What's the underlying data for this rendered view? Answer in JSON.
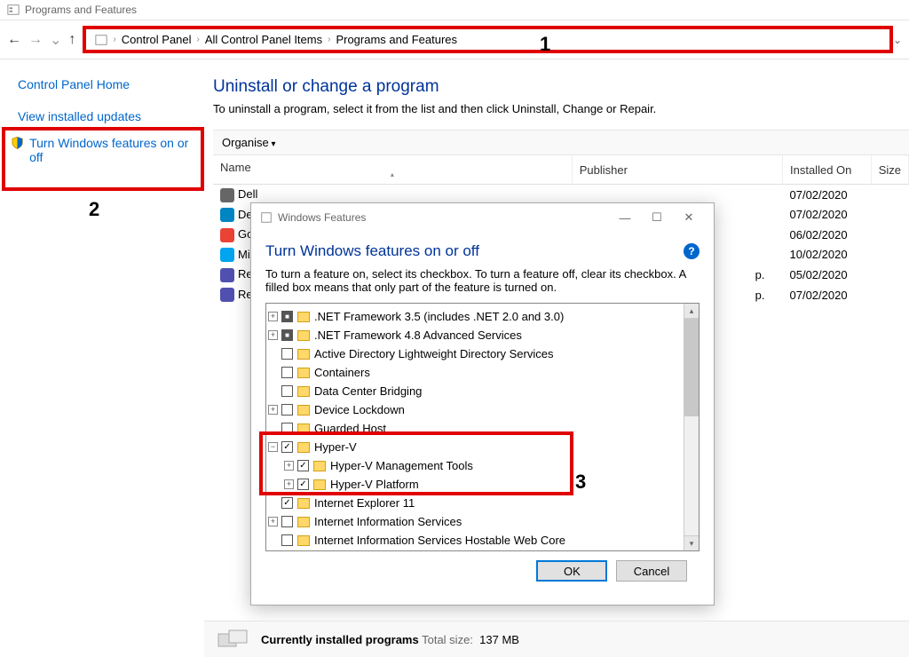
{
  "window_title": "Programs and Features",
  "nav": {
    "back": "←",
    "forward": "→",
    "dropdown": "⌄",
    "up": "↑"
  },
  "breadcrumb": [
    "Control Panel",
    "All Control Panel Items",
    "Programs and Features"
  ],
  "sidebar": {
    "home": "Control Panel Home",
    "updates": "View installed updates",
    "features": "Turn Windows features on or off"
  },
  "page": {
    "heading": "Uninstall or change a program",
    "sub": "To uninstall a program, select it from the list and then click Uninstall, Change or Repair.",
    "organise": "Organise"
  },
  "columns": {
    "name": "Name",
    "publisher": "Publisher",
    "installed": "Installed On",
    "size": "Size"
  },
  "programs": [
    {
      "name": "Dell",
      "installed": "07/02/2020",
      "icon": "#666"
    },
    {
      "name": "Dell",
      "installed": "07/02/2020",
      "icon": "#0085c3"
    },
    {
      "name": "Goo",
      "installed": "06/02/2020",
      "icon": "#ea4335"
    },
    {
      "name": "Micr",
      "installed": "10/02/2020",
      "icon": "#00a4ef"
    },
    {
      "name": "Real",
      "pub_suffix": "p.",
      "installed": "05/02/2020",
      "icon": "#5050b0"
    },
    {
      "name": "Real",
      "pub_suffix": "p.",
      "installed": "07/02/2020",
      "icon": "#5050b0"
    }
  ],
  "dialog": {
    "title": "Windows Features",
    "heading": "Turn Windows features on or off",
    "desc": "To turn a feature on, select its checkbox. To turn a feature off, clear its checkbox. A filled box means that only part of the feature is turned on.",
    "ok": "OK",
    "cancel": "Cancel",
    "features": [
      {
        "exp": "+",
        "cb": "mixed",
        "label": ".NET Framework 3.5 (includes .NET 2.0 and 3.0)",
        "ind": 0
      },
      {
        "exp": "+",
        "cb": "mixed",
        "label": ".NET Framework 4.8 Advanced Services",
        "ind": 0
      },
      {
        "exp": "",
        "cb": "",
        "label": "Active Directory Lightweight Directory Services",
        "ind": 0
      },
      {
        "exp": "",
        "cb": "",
        "label": "Containers",
        "ind": 0
      },
      {
        "exp": "",
        "cb": "",
        "label": "Data Center Bridging",
        "ind": 0
      },
      {
        "exp": "+",
        "cb": "",
        "label": "Device Lockdown",
        "ind": 0
      },
      {
        "exp": "",
        "cb": "",
        "label": "Guarded Host",
        "ind": 0
      },
      {
        "exp": "−",
        "cb": "checked",
        "label": "Hyper-V",
        "ind": 0,
        "hl": true
      },
      {
        "exp": "+",
        "cb": "checked",
        "label": "Hyper-V Management Tools",
        "ind": 1,
        "hl": true
      },
      {
        "exp": "+",
        "cb": "checked",
        "label": "Hyper-V Platform",
        "ind": 1,
        "hl": true
      },
      {
        "exp": "",
        "cb": "checked",
        "label": "Internet Explorer 11",
        "ind": 0
      },
      {
        "exp": "+",
        "cb": "",
        "label": "Internet Information Services",
        "ind": 0
      },
      {
        "exp": "",
        "cb": "",
        "label": "Internet Information Services Hostable Web Core",
        "ind": 0
      }
    ]
  },
  "status": {
    "label": "Currently installed programs",
    "meta": "Total size:",
    "value": "137 MB"
  },
  "callouts": {
    "1": "1",
    "2": "2",
    "3": "3"
  }
}
